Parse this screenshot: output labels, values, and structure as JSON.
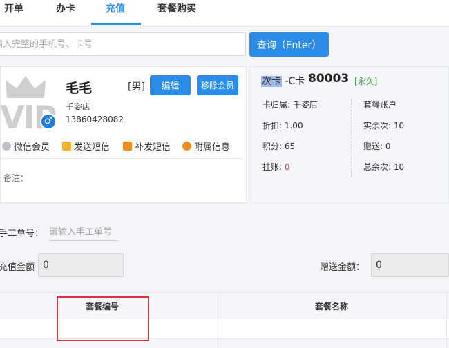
{
  "tabs": [
    {
      "label": "开单",
      "active": false
    },
    {
      "label": "办卡",
      "active": false
    },
    {
      "label": "充值",
      "active": true
    },
    {
      "label": "套餐购买",
      "active": false
    }
  ],
  "search": {
    "placeholder": "输入完整的手机号、卡号",
    "button_label": "查询（Enter）"
  },
  "member": {
    "vip_text": "VIP",
    "name": "毛毛",
    "gender": "[男]",
    "edit_label": "编辑",
    "remove_label": "移除会员",
    "store": "千姿店",
    "phone": "13860428082",
    "actions": [
      "微信会员",
      "发送短信",
      "补发短信",
      "附属信息"
    ],
    "remark_label": "备注："
  },
  "card": {
    "type_highlight": "次卡",
    "type_suffix": "-C卡",
    "number": "80003",
    "validity": "[永久]",
    "left": {
      "store_label": "卡归属: ",
      "store_value": "千姿店",
      "discount_label": "折扣: ",
      "discount_value": "1.00",
      "points_label": "积分: ",
      "points_value": "65",
      "credit_label": "挂账: ",
      "credit_value": "0"
    },
    "right": {
      "package_account": "套餐账户",
      "remaining_label": "实余次: ",
      "remaining_value": "10",
      "gift_label": "赠送: ",
      "gift_value": "0",
      "total_label": "总余次: ",
      "total_value": "10"
    }
  },
  "form": {
    "manual_no_label": "手工单号：",
    "manual_no_placeholder": "请输入手工单号",
    "recharge_amount_label": "充值金额",
    "recharge_amount_value": "0",
    "gift_amount_label": "赠送金额：",
    "gift_amount_value": "0"
  },
  "table": {
    "columns": [
      "套餐编号",
      "套餐名称"
    ]
  },
  "colors": {
    "accent": "#2a8de8",
    "highlight_border": "#d9333f",
    "validity_green": "#3c9c3c",
    "credit_red": "#e03c3c"
  }
}
